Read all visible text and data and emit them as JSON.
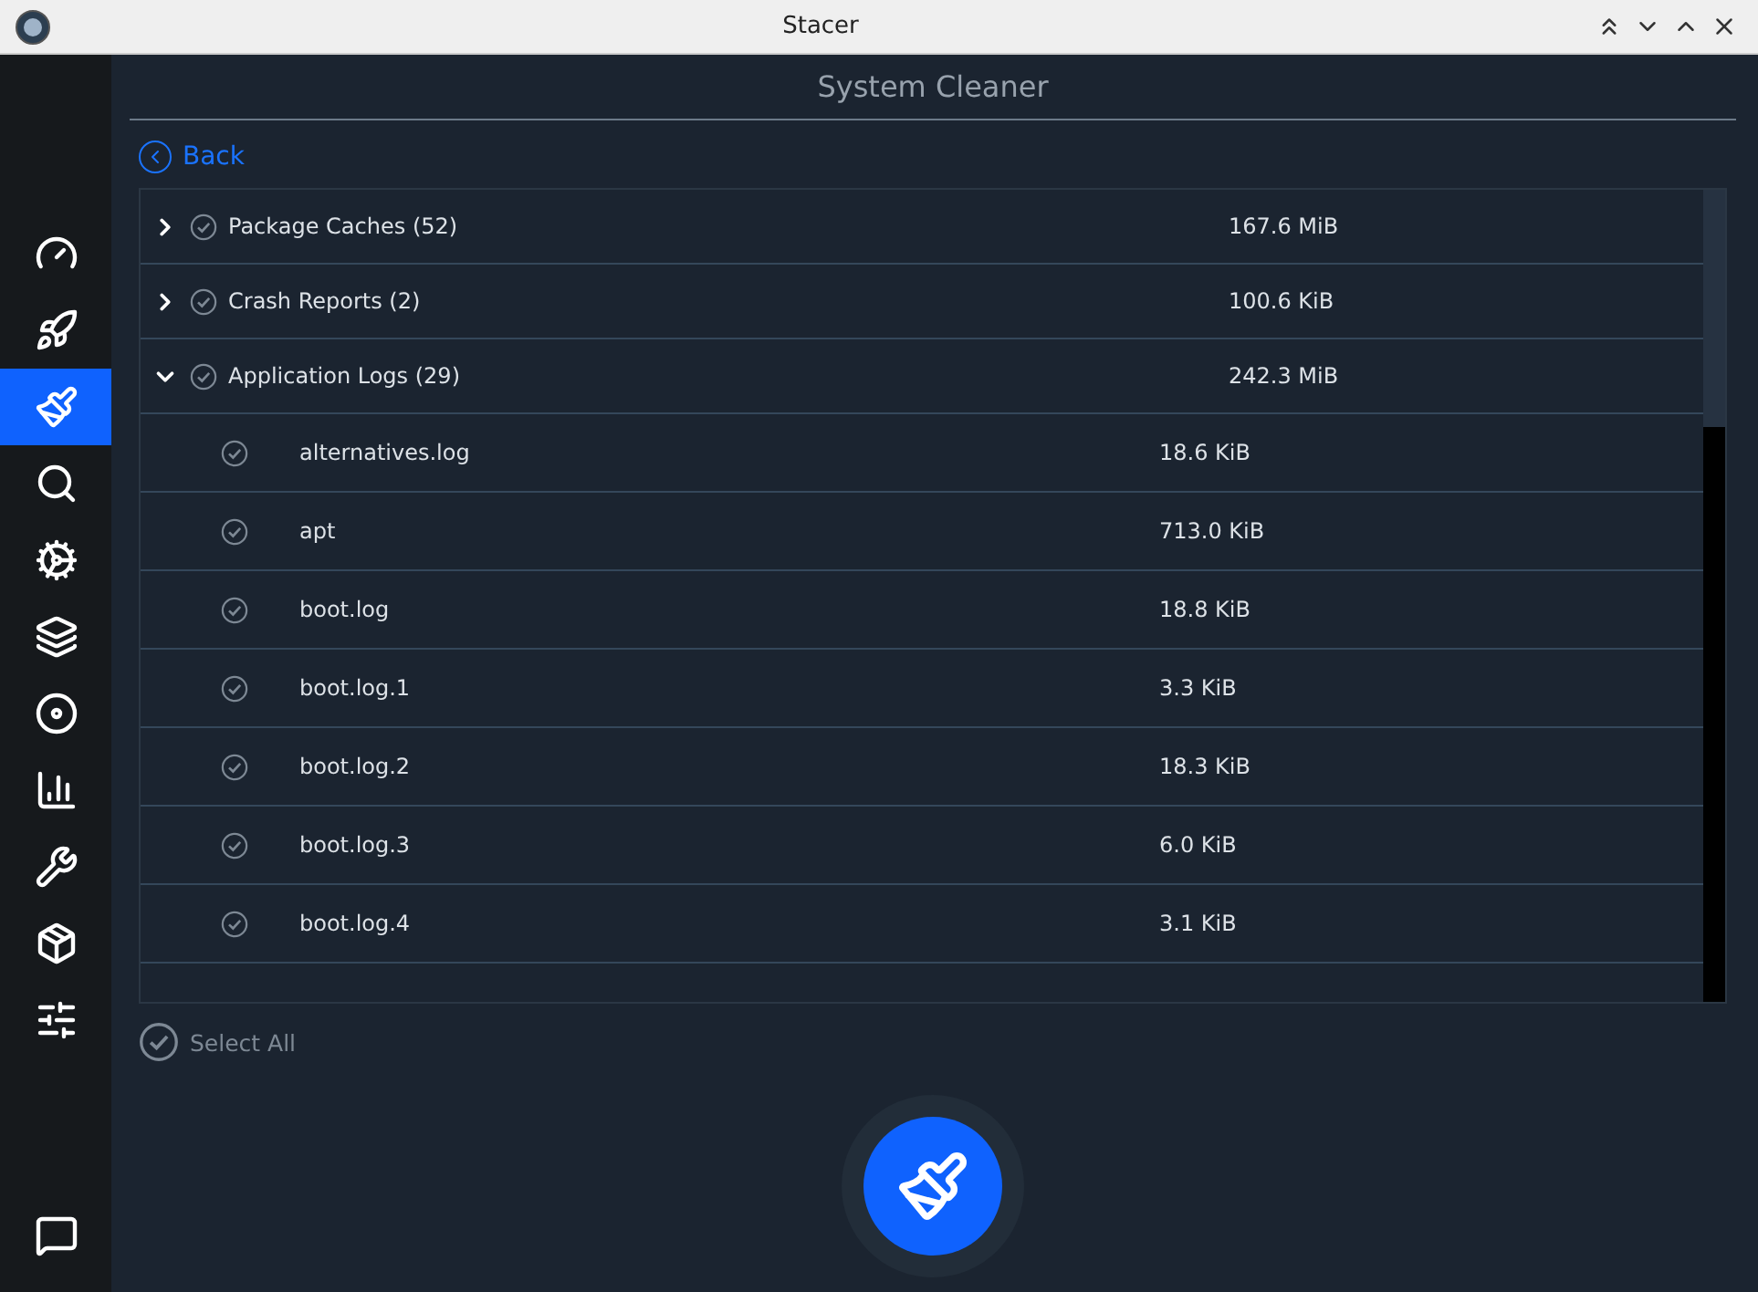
{
  "window": {
    "title": "Stacer"
  },
  "sidebar": {
    "items": [
      {
        "kind": "dashboard",
        "selected": false
      },
      {
        "kind": "startup",
        "selected": false
      },
      {
        "kind": "cleaner",
        "selected": true
      },
      {
        "kind": "search",
        "selected": false
      },
      {
        "kind": "services",
        "selected": false
      },
      {
        "kind": "processes",
        "selected": false
      },
      {
        "kind": "uninstaller",
        "selected": false
      },
      {
        "kind": "resources",
        "selected": false
      },
      {
        "kind": "helpers",
        "selected": false
      },
      {
        "kind": "packages",
        "selected": false
      },
      {
        "kind": "settings",
        "selected": false
      }
    ],
    "footer_item": {
      "kind": "feedback"
    }
  },
  "page": {
    "title": "System Cleaner",
    "back_link": "Back"
  },
  "tree": {
    "rows": [
      {
        "label": "Package Caches (52)",
        "size": "167.6 MiB",
        "checked": true,
        "expanded": false,
        "children": []
      },
      {
        "label": "Crash Reports (2)",
        "size": "100.6 KiB",
        "checked": true,
        "expanded": false,
        "children": []
      },
      {
        "label": "Application Logs (29)",
        "size": "242.3 MiB",
        "checked": true,
        "expanded": true,
        "children": [
          {
            "label": "alternatives.log",
            "size": "18.6 KiB",
            "checked": true
          },
          {
            "label": "apt",
            "size": "713.0 KiB",
            "checked": true
          },
          {
            "label": "boot.log",
            "size": "18.8 KiB",
            "checked": true
          },
          {
            "label": "boot.log.1",
            "size": "3.3 KiB",
            "checked": true
          },
          {
            "label": "boot.log.2",
            "size": "18.3 KiB",
            "checked": true
          },
          {
            "label": "boot.log.3",
            "size": "6.0 KiB",
            "checked": true
          },
          {
            "label": "boot.log.4",
            "size": "3.1 KiB",
            "checked": true
          }
        ]
      }
    ]
  },
  "select_all": {
    "label": "Select All",
    "checked": true
  }
}
